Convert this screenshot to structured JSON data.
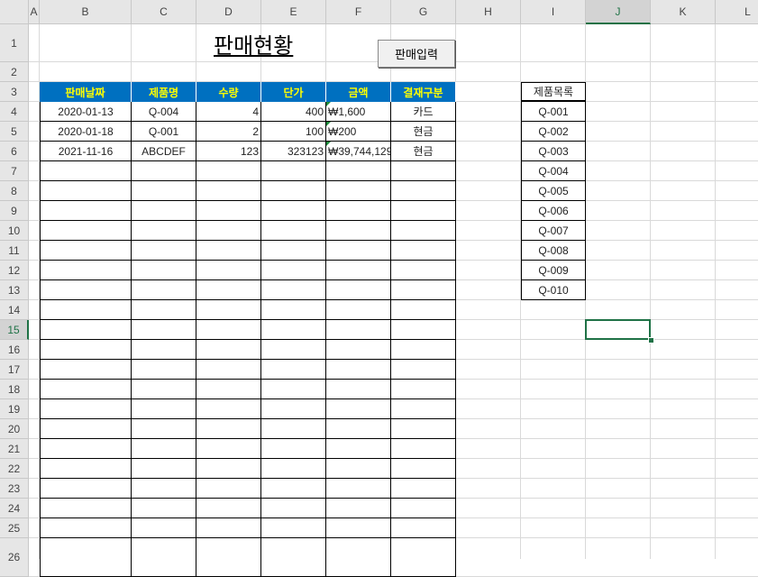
{
  "columns": [
    "A",
    "B",
    "C",
    "D",
    "E",
    "F",
    "G",
    "H",
    "I",
    "J",
    "K",
    "L"
  ],
  "rows": [
    "1",
    "2",
    "3",
    "4",
    "5",
    "6",
    "7",
    "8",
    "9",
    "10",
    "11",
    "12",
    "13",
    "14",
    "15",
    "16",
    "17",
    "18",
    "19",
    "20",
    "21",
    "22",
    "23",
    "24",
    "25",
    "26"
  ],
  "selected_cell": {
    "column": "J",
    "row": "15"
  },
  "sheet": {
    "title": "판매현황",
    "input_button": "판매입력",
    "table_headers": [
      "판매날짜",
      "제품명",
      "수량",
      "단가",
      "금액",
      "결재구분"
    ],
    "table_rows": [
      [
        "2020-01-13",
        "Q-004",
        "4",
        "400",
        "₩1,600",
        "카드"
      ],
      [
        "2020-01-18",
        "Q-001",
        "2",
        "100",
        "₩200",
        "현금"
      ],
      [
        "2021-11-16",
        "ABCDEF",
        "123",
        "323123",
        "₩39,744,129",
        "현금"
      ]
    ],
    "product_list_header": "제품목록",
    "product_list": [
      "Q-001",
      "Q-002",
      "Q-003",
      "Q-004",
      "Q-005",
      "Q-006",
      "Q-007",
      "Q-008",
      "Q-009",
      "Q-010"
    ]
  },
  "colors": {
    "header_fill": "#0070c0",
    "header_text": "#ffff00",
    "selection": "#1f7246"
  }
}
